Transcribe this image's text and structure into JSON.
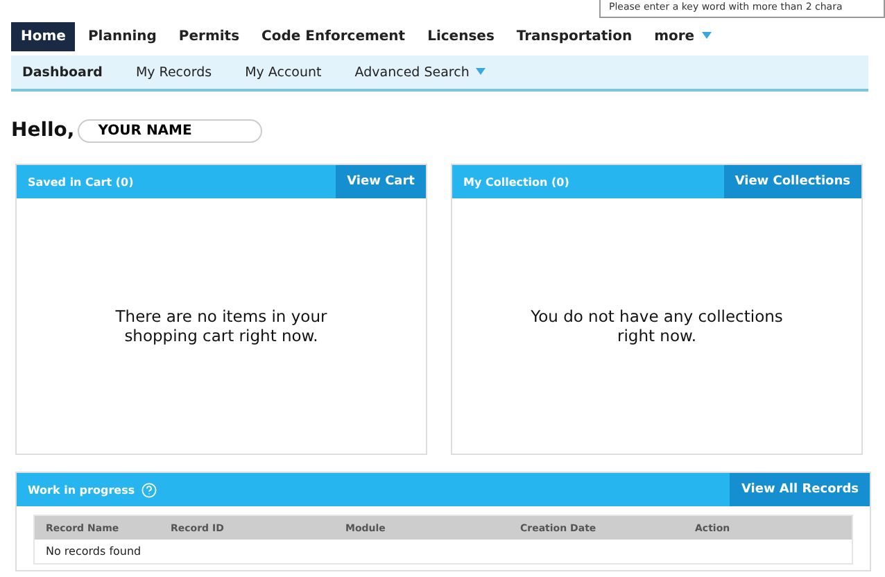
{
  "tooltip": "Please enter a key word with more than 2 chara",
  "nav_tabs": [
    {
      "label": "Home",
      "selected": true
    },
    {
      "label": "Planning",
      "selected": false
    },
    {
      "label": "Permits",
      "selected": false
    },
    {
      "label": "Code Enforcement",
      "selected": false
    },
    {
      "label": "Licenses",
      "selected": false
    },
    {
      "label": "Transportation",
      "selected": false
    },
    {
      "label": "more",
      "selected": false,
      "dropdown": true
    }
  ],
  "sub_nav": [
    {
      "label": "Dashboard",
      "selected": true
    },
    {
      "label": "My Records",
      "selected": false
    },
    {
      "label": "My Account",
      "selected": false
    },
    {
      "label": "Advanced Search",
      "selected": false,
      "dropdown": true
    }
  ],
  "greeting": {
    "label": "Hello,",
    "name": "YOUR NAME"
  },
  "cards": [
    {
      "title": "Saved in Cart (0)",
      "button": "View Cart",
      "message": "There are no items in your shopping cart right now."
    },
    {
      "title": "My Collection (0)",
      "button": "View Collections",
      "message": "You do not have any collections right now."
    }
  ],
  "work_in_progress": {
    "title": "Work in progress",
    "button": "View All Records",
    "table": {
      "columns": [
        "Record Name",
        "Record ID",
        "Module",
        "Creation Date",
        "Action"
      ],
      "empty_message": "No records found"
    }
  }
}
